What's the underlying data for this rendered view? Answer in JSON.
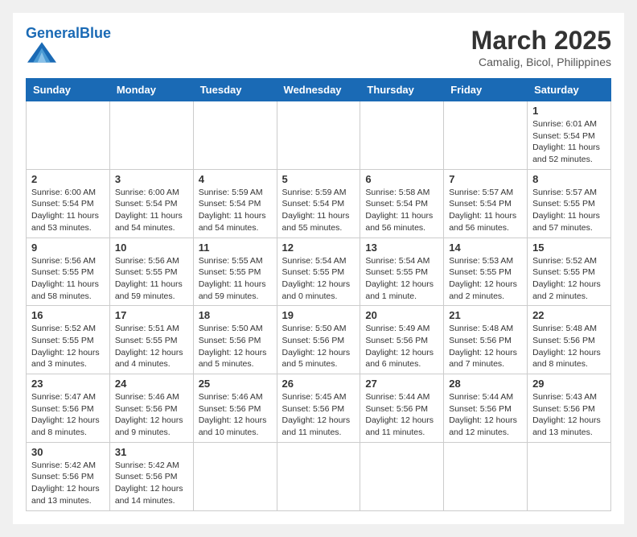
{
  "logo": {
    "text_general": "General",
    "text_blue": "Blue"
  },
  "title": {
    "month_year": "March 2025",
    "location": "Camalig, Bicol, Philippines"
  },
  "weekdays": [
    "Sunday",
    "Monday",
    "Tuesday",
    "Wednesday",
    "Thursday",
    "Friday",
    "Saturday"
  ],
  "days": [
    {
      "num": "",
      "info": ""
    },
    {
      "num": "",
      "info": ""
    },
    {
      "num": "",
      "info": ""
    },
    {
      "num": "",
      "info": ""
    },
    {
      "num": "",
      "info": ""
    },
    {
      "num": "",
      "info": ""
    },
    {
      "num": "1",
      "info": "Sunrise: 6:01 AM\nSunset: 5:54 PM\nDaylight: 11 hours\nand 52 minutes."
    },
    {
      "num": "2",
      "info": "Sunrise: 6:00 AM\nSunset: 5:54 PM\nDaylight: 11 hours\nand 53 minutes."
    },
    {
      "num": "3",
      "info": "Sunrise: 6:00 AM\nSunset: 5:54 PM\nDaylight: 11 hours\nand 54 minutes."
    },
    {
      "num": "4",
      "info": "Sunrise: 5:59 AM\nSunset: 5:54 PM\nDaylight: 11 hours\nand 54 minutes."
    },
    {
      "num": "5",
      "info": "Sunrise: 5:59 AM\nSunset: 5:54 PM\nDaylight: 11 hours\nand 55 minutes."
    },
    {
      "num": "6",
      "info": "Sunrise: 5:58 AM\nSunset: 5:54 PM\nDaylight: 11 hours\nand 56 minutes."
    },
    {
      "num": "7",
      "info": "Sunrise: 5:57 AM\nSunset: 5:54 PM\nDaylight: 11 hours\nand 56 minutes."
    },
    {
      "num": "8",
      "info": "Sunrise: 5:57 AM\nSunset: 5:55 PM\nDaylight: 11 hours\nand 57 minutes."
    },
    {
      "num": "9",
      "info": "Sunrise: 5:56 AM\nSunset: 5:55 PM\nDaylight: 11 hours\nand 58 minutes."
    },
    {
      "num": "10",
      "info": "Sunrise: 5:56 AM\nSunset: 5:55 PM\nDaylight: 11 hours\nand 59 minutes."
    },
    {
      "num": "11",
      "info": "Sunrise: 5:55 AM\nSunset: 5:55 PM\nDaylight: 11 hours\nand 59 minutes."
    },
    {
      "num": "12",
      "info": "Sunrise: 5:54 AM\nSunset: 5:55 PM\nDaylight: 12 hours\nand 0 minutes."
    },
    {
      "num": "13",
      "info": "Sunrise: 5:54 AM\nSunset: 5:55 PM\nDaylight: 12 hours\nand 1 minute."
    },
    {
      "num": "14",
      "info": "Sunrise: 5:53 AM\nSunset: 5:55 PM\nDaylight: 12 hours\nand 2 minutes."
    },
    {
      "num": "15",
      "info": "Sunrise: 5:52 AM\nSunset: 5:55 PM\nDaylight: 12 hours\nand 2 minutes."
    },
    {
      "num": "16",
      "info": "Sunrise: 5:52 AM\nSunset: 5:55 PM\nDaylight: 12 hours\nand 3 minutes."
    },
    {
      "num": "17",
      "info": "Sunrise: 5:51 AM\nSunset: 5:55 PM\nDaylight: 12 hours\nand 4 minutes."
    },
    {
      "num": "18",
      "info": "Sunrise: 5:50 AM\nSunset: 5:56 PM\nDaylight: 12 hours\nand 5 minutes."
    },
    {
      "num": "19",
      "info": "Sunrise: 5:50 AM\nSunset: 5:56 PM\nDaylight: 12 hours\nand 5 minutes."
    },
    {
      "num": "20",
      "info": "Sunrise: 5:49 AM\nSunset: 5:56 PM\nDaylight: 12 hours\nand 6 minutes."
    },
    {
      "num": "21",
      "info": "Sunrise: 5:48 AM\nSunset: 5:56 PM\nDaylight: 12 hours\nand 7 minutes."
    },
    {
      "num": "22",
      "info": "Sunrise: 5:48 AM\nSunset: 5:56 PM\nDaylight: 12 hours\nand 8 minutes."
    },
    {
      "num": "23",
      "info": "Sunrise: 5:47 AM\nSunset: 5:56 PM\nDaylight: 12 hours\nand 8 minutes."
    },
    {
      "num": "24",
      "info": "Sunrise: 5:46 AM\nSunset: 5:56 PM\nDaylight: 12 hours\nand 9 minutes."
    },
    {
      "num": "25",
      "info": "Sunrise: 5:46 AM\nSunset: 5:56 PM\nDaylight: 12 hours\nand 10 minutes."
    },
    {
      "num": "26",
      "info": "Sunrise: 5:45 AM\nSunset: 5:56 PM\nDaylight: 12 hours\nand 11 minutes."
    },
    {
      "num": "27",
      "info": "Sunrise: 5:44 AM\nSunset: 5:56 PM\nDaylight: 12 hours\nand 11 minutes."
    },
    {
      "num": "28",
      "info": "Sunrise: 5:44 AM\nSunset: 5:56 PM\nDaylight: 12 hours\nand 12 minutes."
    },
    {
      "num": "29",
      "info": "Sunrise: 5:43 AM\nSunset: 5:56 PM\nDaylight: 12 hours\nand 13 minutes."
    },
    {
      "num": "30",
      "info": "Sunrise: 5:42 AM\nSunset: 5:56 PM\nDaylight: 12 hours\nand 13 minutes."
    },
    {
      "num": "31",
      "info": "Sunrise: 5:42 AM\nSunset: 5:56 PM\nDaylight: 12 hours\nand 14 minutes."
    },
    {
      "num": "",
      "info": ""
    },
    {
      "num": "",
      "info": ""
    },
    {
      "num": "",
      "info": ""
    },
    {
      "num": "",
      "info": ""
    },
    {
      "num": "",
      "info": ""
    }
  ]
}
